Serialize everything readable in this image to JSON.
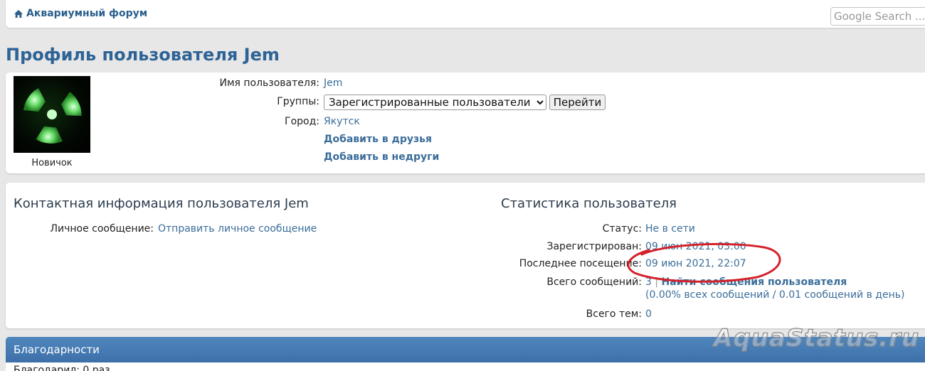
{
  "nav": {
    "home_label": "Аквариумный форум",
    "search_placeholder": "Google Search ..."
  },
  "page_title": "Профиль пользователя Jem",
  "profile": {
    "rank": "Новичок",
    "username_label": "Имя пользователя:",
    "username": "Jem",
    "groups_label": "Группы:",
    "groups_selected": "Зарегистрированные пользователи",
    "go_button": "Перейти",
    "city_label": "Город:",
    "city": "Якутск",
    "add_friend": "Добавить в друзья",
    "add_foe": "Добавить в недруги"
  },
  "contact": {
    "title": "Контактная информация пользователя Jem",
    "pm_label": "Личное сообщение:",
    "pm_link": "Отправить личное сообщение"
  },
  "stats": {
    "title": "Статистика пользователя",
    "status_label": "Статус:",
    "status": "Не в сети",
    "registered_label": "Зарегистрирован:",
    "registered": "09 июн 2021, 03:00",
    "last_visit_label": "Последнее посещение:",
    "last_visit": "09 июн 2021, 22:07",
    "posts_label": "Всего сообщений:",
    "posts_count": "3",
    "posts_separator": "|",
    "find_posts": "Найти сообщения пользователя",
    "posts_detail": "(0.00% всех сообщений / 0.01 сообщений в день)",
    "topics_label": "Всего тем:",
    "topics_count": "0"
  },
  "thanks": {
    "title": "Благодарности",
    "body_partial": "Благодарил: 0 раз"
  },
  "overlay": {
    "watermark": "AquaStatus.ru",
    "highlight_color": "#d4212b"
  },
  "icons": {
    "home": "home-icon",
    "avatar": "radiation-icon"
  }
}
